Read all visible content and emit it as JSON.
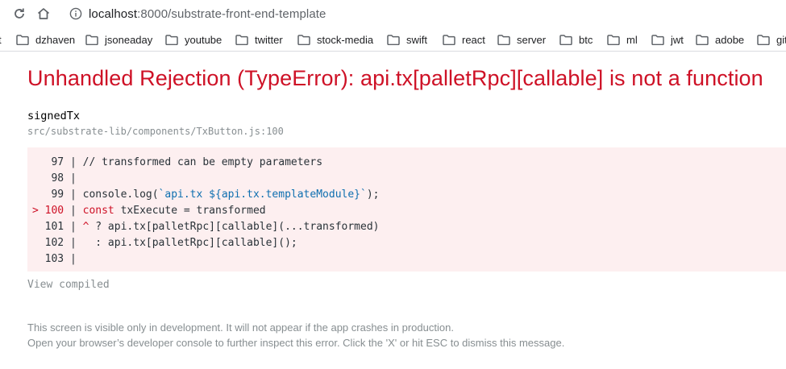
{
  "browser": {
    "url_host": "localhost",
    "url_rest": ":8000/substrate-front-end-template",
    "bookmarks": [
      {
        "label": "t"
      },
      {
        "label": "dzhaven"
      },
      {
        "label": "jsoneaday"
      },
      {
        "label": "youtube"
      },
      {
        "label": "twitter"
      },
      {
        "label": "stock-media"
      },
      {
        "label": "swift"
      },
      {
        "label": "react"
      },
      {
        "label": "server"
      },
      {
        "label": "btc"
      },
      {
        "label": "ml"
      },
      {
        "label": "jwt"
      },
      {
        "label": "adobe"
      },
      {
        "label": "git"
      }
    ]
  },
  "error": {
    "title": "Unhandled Rejection (TypeError): api.tx[palletRpc][callable] is not a function",
    "function_name": "signedTx",
    "file_location": "src/substrate-lib/components/TxButton.js:100",
    "view_compiled": "View compiled",
    "code": {
      "l97_prefix": "   97 | ",
      "l97_code": "// transformed can be empty parameters",
      "l98": "   98 |",
      "l99_prefix": "   99 | ",
      "l99_code_a": "console.log(",
      "l99_str": "`api.tx ${api.tx.templateModule}`",
      "l99_code_b": ");",
      "l100_marker": "> 100",
      "l100_sep": " | ",
      "l100_kw": "const",
      "l100_code": " txExecute = transformed",
      "l101_prefix": "  101 | ",
      "l101_caret": "^",
      "l101_code": " ? api.tx[palletRpc][callable](...transformed)",
      "l102_prefix": "  102 | ",
      "l102_code": "  : api.tx[palletRpc][callable]();",
      "l103": "  103 |"
    },
    "footer_line1": "This screen is visible only in development. It will not appear if the app crashes in production.",
    "footer_line2": "Open your browser’s developer console to further inspect this error.  Click the 'X' or hit ESC to dismiss this message."
  },
  "colors": {
    "error_red": "#ce1126",
    "code_background": "#fdeff0",
    "muted_gray": "#878e91",
    "string_blue": "#0e6fb0"
  }
}
